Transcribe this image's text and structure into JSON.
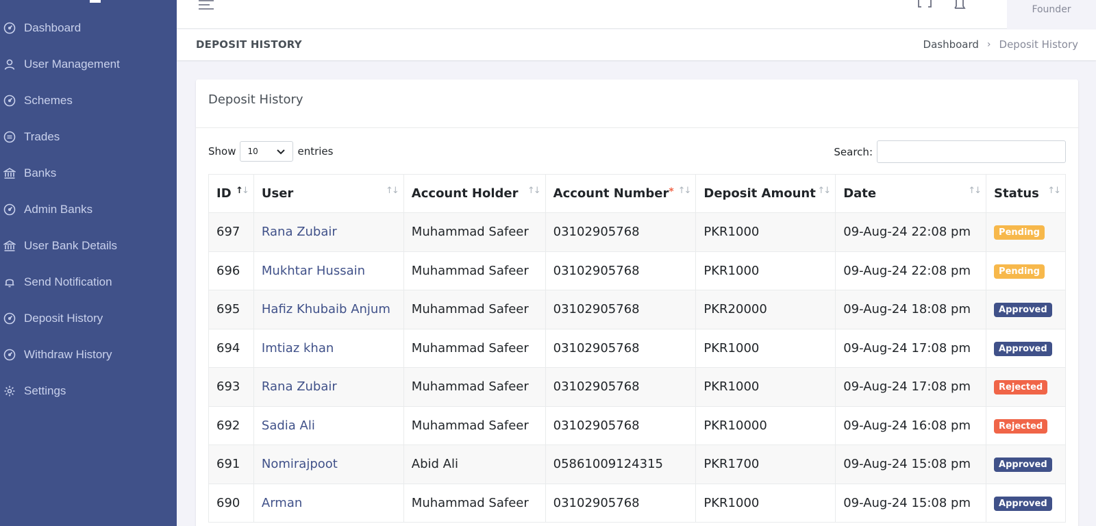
{
  "sidebar": {
    "items": [
      {
        "label": "Dashboard",
        "icon": "speedometer-icon"
      },
      {
        "label": "User Management",
        "icon": "user-icon"
      },
      {
        "label": "Schemes",
        "icon": "speedometer-icon"
      },
      {
        "label": "Trades",
        "icon": "exchange-icon"
      },
      {
        "label": "Banks",
        "icon": "bank-icon"
      },
      {
        "label": "Admin Banks",
        "icon": "speedometer-icon"
      },
      {
        "label": "User Bank Details",
        "icon": "bank-icon"
      },
      {
        "label": "Send Notification",
        "icon": "bell-icon"
      },
      {
        "label": "Deposit History",
        "icon": "speedometer-icon"
      },
      {
        "label": "Withdraw History",
        "icon": "speedometer-icon"
      },
      {
        "label": "Settings",
        "icon": "gear-icon"
      }
    ]
  },
  "topbar": {
    "user_role": "Founder"
  },
  "page": {
    "title": "DEPOSIT HISTORY",
    "breadcrumb": {
      "home": "Dashboard",
      "separator": "›",
      "current": "Deposit History"
    }
  },
  "card": {
    "title": "Deposit History",
    "show_label": "Show",
    "entries_value": "10",
    "entries_label": "entries",
    "search_label": "Search:",
    "search_value": ""
  },
  "table": {
    "columns": [
      "ID",
      "User",
      "Account Holder",
      "Account Number",
      "Deposit Amount",
      "Date",
      "Status"
    ],
    "rows": [
      {
        "id": "697",
        "user": "Rana Zubair",
        "holder": "Muhammad Safeer",
        "account": "03102905768",
        "amount": "PKR1000",
        "date": "09-Aug-24 22:08 pm",
        "status": "Pending"
      },
      {
        "id": "696",
        "user": "Mukhtar Hussain",
        "holder": "Muhammad Safeer",
        "account": "03102905768",
        "amount": "PKR1000",
        "date": "09-Aug-24 22:08 pm",
        "status": "Pending"
      },
      {
        "id": "695",
        "user": "Hafiz Khubaib Anjum",
        "holder": "Muhammad Safeer",
        "account": "03102905768",
        "amount": "PKR20000",
        "date": "09-Aug-24 18:08 pm",
        "status": "Approved"
      },
      {
        "id": "694",
        "user": "Imtiaz khan",
        "holder": "Muhammad Safeer",
        "account": "03102905768",
        "amount": "PKR1000",
        "date": "09-Aug-24 17:08 pm",
        "status": "Approved"
      },
      {
        "id": "693",
        "user": "Rana Zubair",
        "holder": "Muhammad Safeer",
        "account": "03102905768",
        "amount": "PKR1000",
        "date": "09-Aug-24 17:08 pm",
        "status": "Rejected"
      },
      {
        "id": "692",
        "user": "Sadia Ali",
        "holder": "Muhammad Safeer",
        "account": "03102905768",
        "amount": "PKR10000",
        "date": "09-Aug-24 16:08 pm",
        "status": "Rejected"
      },
      {
        "id": "691",
        "user": "Nomirajpoot",
        "holder": "Abid Ali",
        "account": "05861009124315",
        "amount": "PKR1700",
        "date": "09-Aug-24 15:08 pm",
        "status": "Approved"
      },
      {
        "id": "690",
        "user": "Arman",
        "holder": "Muhammad Safeer",
        "account": "03102905768",
        "amount": "PKR1000",
        "date": "09-Aug-24 15:08 pm",
        "status": "Approved"
      }
    ]
  },
  "colors": {
    "sidebar_bg": "#405189",
    "pending": "#f7b84b",
    "approved": "#405189",
    "rejected": "#f06548"
  }
}
